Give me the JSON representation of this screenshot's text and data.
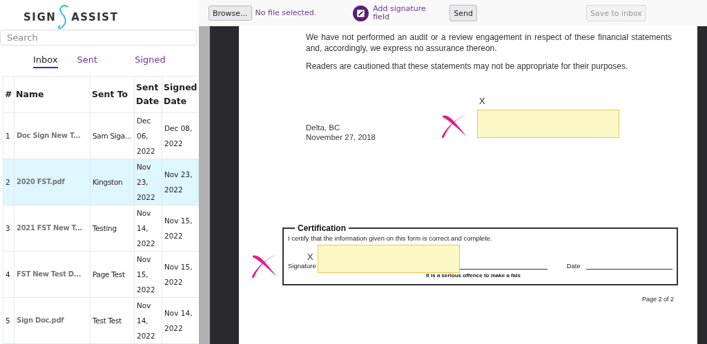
{
  "logo": {
    "left": "SIGN",
    "right": "ASSIST"
  },
  "search": {
    "placeholder": "Search"
  },
  "tabs": [
    {
      "label": "Inbox",
      "selected": true
    },
    {
      "label": "Sent",
      "selected": false
    },
    {
      "label": "Signed",
      "selected": false
    }
  ],
  "table": {
    "columns": [
      "#",
      "Name",
      "Sent To",
      "Sent Date",
      "Signed Date"
    ],
    "rows": [
      {
        "selected": false,
        "cells": [
          "1",
          "Doc Sign New T...",
          "Sam Siga...",
          "Dec 06, 2022",
          "Dec 08, 2022"
        ]
      },
      {
        "selected": true,
        "cells": [
          "2",
          "2020 FST.pdf",
          "Kingston",
          "Nov 23, 2022",
          "Nov 23, 2022"
        ]
      },
      {
        "selected": false,
        "cells": [
          "3",
          "2021 FST New T...",
          "Testing",
          "Nov 14, 2022",
          "Nov 15, 2022"
        ]
      },
      {
        "selected": false,
        "cells": [
          "4",
          "FST New Test D...",
          "Page Test",
          "Nov 15, 2022",
          "Nov 15, 2022"
        ]
      },
      {
        "selected": false,
        "cells": [
          "5",
          "Sign Doc.pdf",
          "Test Test",
          "Nov 14, 2022",
          "Nov 14, 2022"
        ]
      }
    ]
  },
  "toolbar": {
    "browse_button": "Browse...",
    "file_status": "No file selected.",
    "add_field": "Add signature field",
    "send_button": "Send",
    "save_button": {
      "label": "Save to inbox",
      "disabled": true
    }
  },
  "document": {
    "paragraphs": [
      "We have not performed an audit or a review engagement in respect of these financial statements and, accordingly, we express no assurance thereon.",
      "Readers are cautioned that these statements may not be appropriate for their purposes."
    ],
    "place_lines": [
      "Delta, BC",
      "November 27, 2018"
    ],
    "certification": {
      "title": "Certification",
      "statement": "I certify that the information given on this form is correct and complete.",
      "signature_label": "Signature",
      "date_label": "Date",
      "warning": "It is a serious offence to make a fals"
    },
    "footer": "Page 2 of 2",
    "signature_fields": [
      {
        "label": "X"
      },
      {
        "label": "X"
      }
    ]
  }
}
